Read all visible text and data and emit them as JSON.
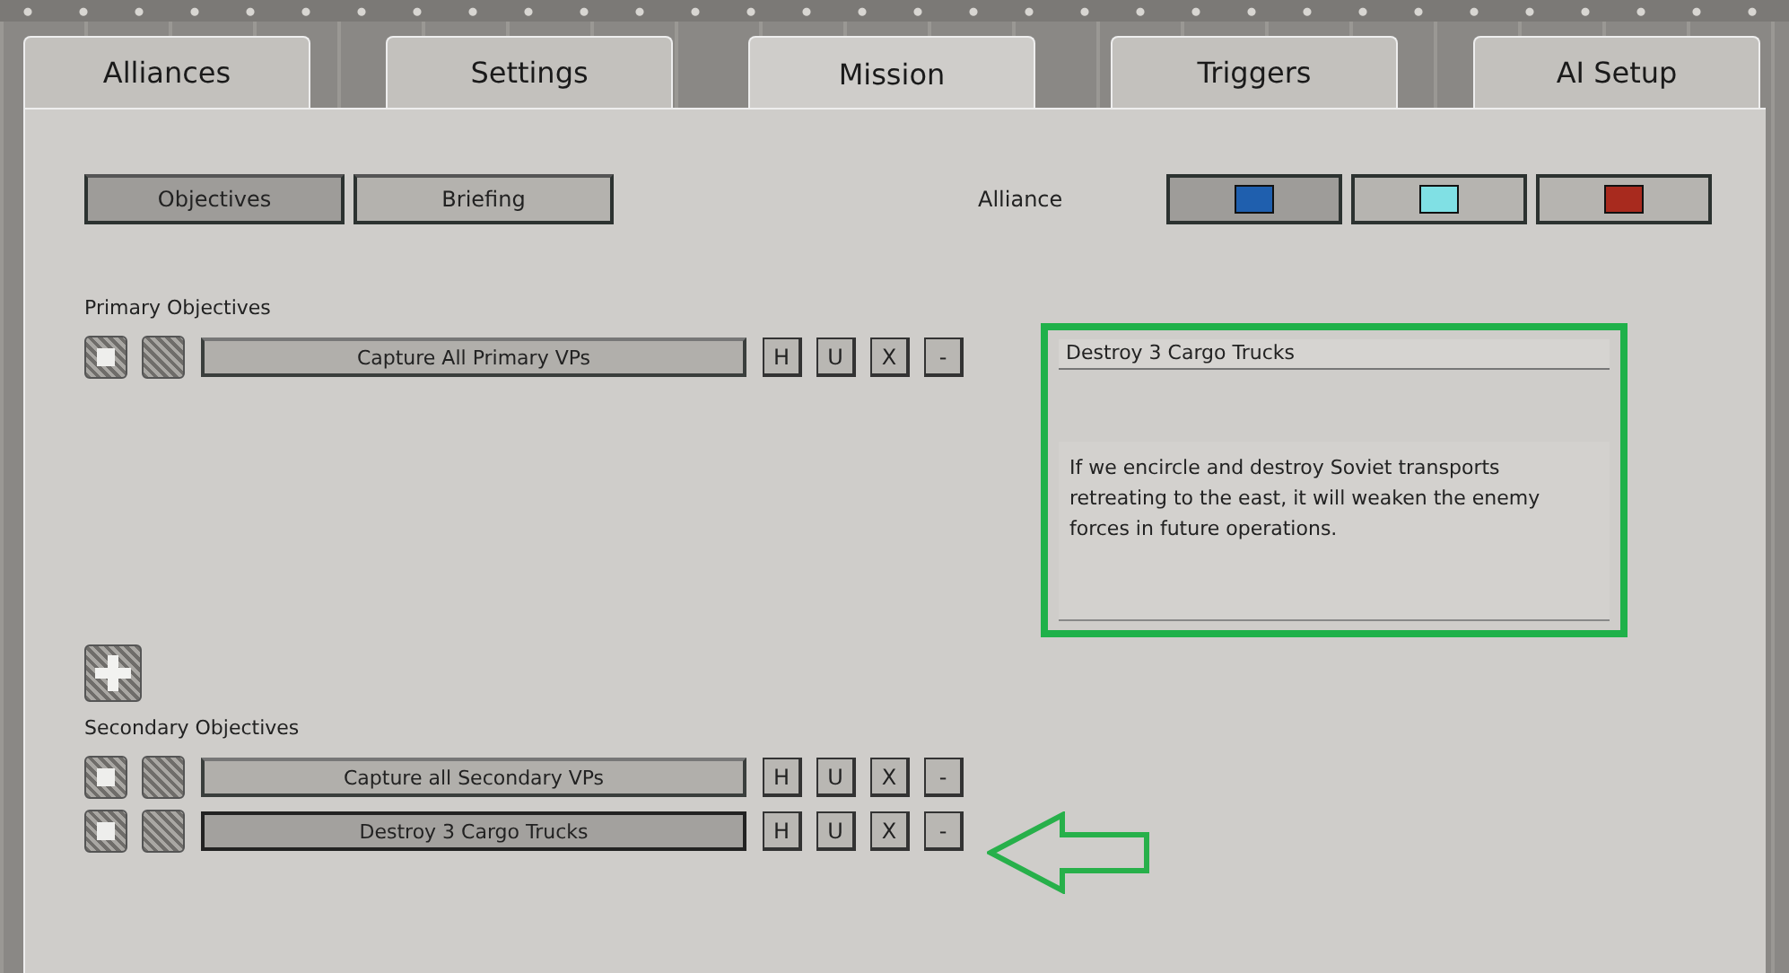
{
  "tabs": [
    {
      "label": "Alliances",
      "selected": false
    },
    {
      "label": "Settings",
      "selected": false
    },
    {
      "label": "Mission",
      "selected": true
    },
    {
      "label": "Triggers",
      "selected": false
    },
    {
      "label": "AI Setup",
      "selected": false
    }
  ],
  "view_buttons": [
    {
      "label": "Objectives",
      "selected": true
    },
    {
      "label": "Briefing",
      "selected": false
    }
  ],
  "alliance": {
    "label": "Alliance",
    "options": [
      {
        "color": "#1f5fae",
        "selected": true
      },
      {
        "color": "#80e0e4",
        "selected": false
      },
      {
        "color": "#a82a1e",
        "selected": false
      }
    ]
  },
  "primary": {
    "heading": "Primary Objectives",
    "objectives": [
      {
        "name": "Capture All Primary VPs",
        "checked": true,
        "selected": false,
        "highlighted": false,
        "actions": [
          "H",
          "U",
          "X",
          "-"
        ]
      }
    ]
  },
  "secondary": {
    "heading": "Secondary Objectives",
    "objectives": [
      {
        "name": "Capture all Secondary VPs",
        "checked": true,
        "selected": false,
        "highlighted": false,
        "actions": [
          "H",
          "U",
          "X",
          "-"
        ]
      },
      {
        "name": "Destroy 3 Cargo Trucks",
        "checked": true,
        "selected": true,
        "highlighted": true,
        "actions": [
          "H",
          "U",
          "X",
          "-"
        ]
      }
    ]
  },
  "details": {
    "title": "Destroy 3 Cargo Trucks",
    "description": "If we encircle and destroy Soviet transports retreating to the east, it will weaken the enemy forces in future operations.",
    "highlighted": true
  }
}
